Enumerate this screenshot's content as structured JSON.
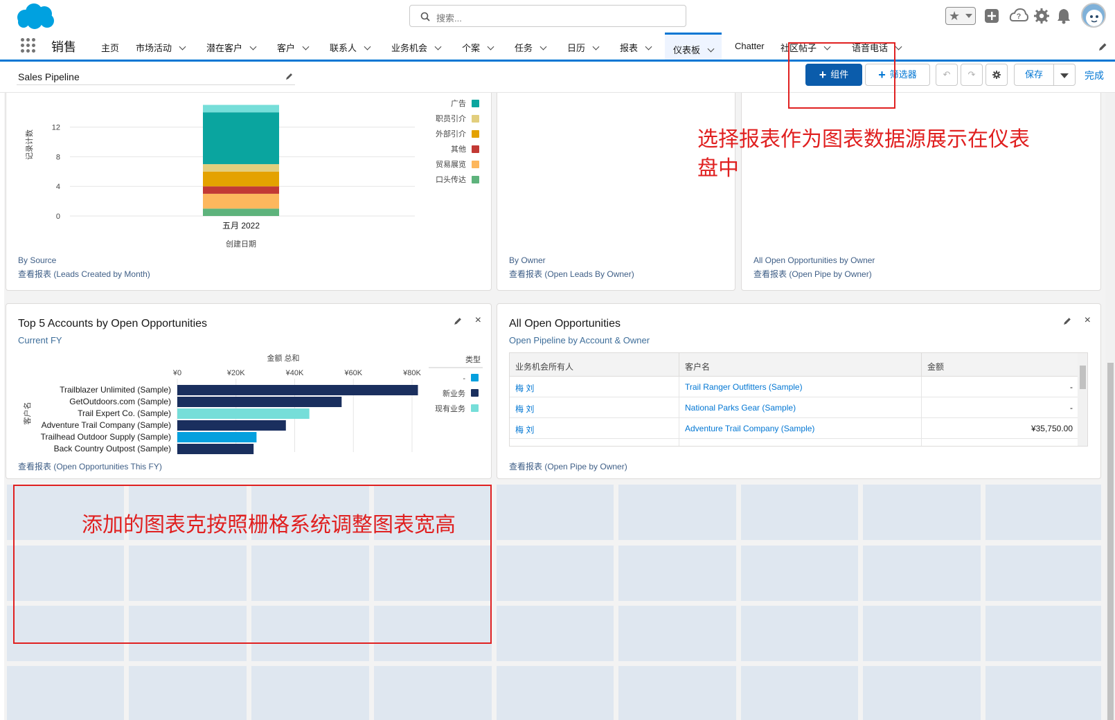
{
  "header": {
    "search_placeholder": "搜索...",
    "icons": [
      "favorites-star-icon",
      "add-icon",
      "help-icon",
      "setup-gear-icon",
      "notifications-bell-icon",
      "avatar"
    ]
  },
  "nav": {
    "app_name": "销售",
    "items": [
      {
        "label": "主页",
        "has_menu": false
      },
      {
        "label": "市场活动",
        "has_menu": true
      },
      {
        "label": "潜在客户",
        "has_menu": true
      },
      {
        "label": "客户",
        "has_menu": true
      },
      {
        "label": "联系人",
        "has_menu": true
      },
      {
        "label": "业务机会",
        "has_menu": true
      },
      {
        "label": "个案",
        "has_menu": true
      },
      {
        "label": "任务",
        "has_menu": true
      },
      {
        "label": "日历",
        "has_menu": true
      },
      {
        "label": "报表",
        "has_menu": true
      },
      {
        "label": "仪表板",
        "has_menu": true,
        "active": true
      },
      {
        "label": "Chatter",
        "has_menu": false
      },
      {
        "label": "社区帖子",
        "has_menu": true
      },
      {
        "label": "语音电话",
        "has_menu": true
      }
    ]
  },
  "toolbar": {
    "dashboard_name": "Sales Pipeline",
    "component_button": "组件",
    "filter_button": "筛选器",
    "save_button": "保存",
    "done_link": "完成"
  },
  "cards": {
    "by_source": {
      "subtitle": "By Source",
      "footer": "查看报表 (Leads Created by Month)",
      "ylabel": "记录计数",
      "xlabel": "创建日期",
      "category": "五月 2022",
      "yticks": [
        "12",
        "8",
        "4",
        "0"
      ]
    },
    "by_owner": {
      "subtitle": "By Owner",
      "footer": "查看报表 (Open Leads By Owner)"
    },
    "open_pipe": {
      "subtitle": "All Open Opportunities by Owner",
      "footer": "查看报表 (Open Pipe by Owner)"
    },
    "top5": {
      "title": "Top 5 Accounts by Open Opportunities",
      "subtitle": "Current FY",
      "footer": "查看报表 (Open Opportunities This FY)",
      "axis_title": "金额 总和",
      "ylabel": "客户名",
      "legend_title": "类型",
      "xticks": [
        "¥0",
        "¥20K",
        "¥40K",
        "¥60K",
        "¥80K"
      ]
    },
    "all_open": {
      "title": "All Open Opportunities",
      "subtitle": "Open Pipeline by Account & Owner",
      "footer": "查看报表 (Open Pipe by Owner)",
      "columns": [
        "业务机会所有人",
        "客户名",
        "金额"
      ],
      "rows": [
        {
          "owner": "梅 刘",
          "account": "Trail Ranger Outfitters (Sample)",
          "amount": "-"
        },
        {
          "owner": "梅 刘",
          "account": "National Parks Gear (Sample)",
          "amount": "-"
        },
        {
          "owner": "梅 刘",
          "account": "Adventure Trail Company (Sample)",
          "amount": "¥35,750.00"
        }
      ]
    }
  },
  "chart_data": [
    {
      "type": "bar",
      "stacked": true,
      "categories": [
        "五月 2022"
      ],
      "xlabel": "创建日期",
      "ylabel": "记录计数",
      "ylim": [
        0,
        14
      ],
      "series": [
        {
          "name": "口头传达",
          "values": [
            1
          ],
          "color": "#5eb37c"
        },
        {
          "name": "贸易展览",
          "values": [
            2
          ],
          "color": "#fdb75d"
        },
        {
          "name": "其他",
          "values": [
            1
          ],
          "color": "#c23934"
        },
        {
          "name": "外部引介",
          "values": [
            2
          ],
          "color": "#e4a200"
        },
        {
          "name": "职员引介",
          "values": [
            1
          ],
          "color": "#e2ce7d"
        },
        {
          "name": "广告",
          "values": [
            7
          ],
          "color": "#0aa59f"
        },
        {
          "name": "",
          "values": [
            1
          ],
          "color": "#76ded9"
        }
      ],
      "legend": [
        {
          "name": "广告",
          "color": "#0aa59f"
        },
        {
          "name": "职员引介",
          "color": "#e2ce7d"
        },
        {
          "name": "外部引介",
          "color": "#e4a200"
        },
        {
          "name": "其他",
          "color": "#c23934"
        },
        {
          "name": "贸易展览",
          "color": "#fdb75d"
        },
        {
          "name": "口头传达",
          "color": "#5eb37c"
        }
      ],
      "legend_position": "right"
    },
    {
      "type": "bar",
      "orientation": "horizontal",
      "title": "Top 5 Accounts by Open Opportunities",
      "xlabel": "金额 总和",
      "ylabel": "客户名",
      "xlim": [
        0,
        80000
      ],
      "categories": [
        "Trailblazer Unlimited (Sample)",
        "GetOutdoors.com (Sample)",
        "Trail Expert Co. (Sample)",
        "Adventure Trail Company (Sample)",
        "Trailhead Outdoor Supply (Sample)",
        "Back Country Outpost (Sample)"
      ],
      "values": [
        82000,
        56000,
        45000,
        37000,
        27000,
        26000
      ],
      "types": [
        "新业务",
        "新业务",
        "现有业务",
        "新业务",
        "-",
        "新业务"
      ],
      "legend": [
        {
          "name": "-",
          "color": "#06a0de"
        },
        {
          "name": "新业务",
          "color": "#1a2f5e"
        },
        {
          "name": "现有业务",
          "color": "#76ded9"
        }
      ],
      "legend_title": "类型"
    }
  ],
  "annotations": {
    "component_note": "选择报表作为图表数据源展示在仪表盘中",
    "grid_note": "添加的图表克按照栅格系统调整图表宽高"
  },
  "colors": {
    "brand": "#0b5cab",
    "link": "#0176d3",
    "annotation": "#e02020",
    "grid": "#dfe7f0"
  }
}
